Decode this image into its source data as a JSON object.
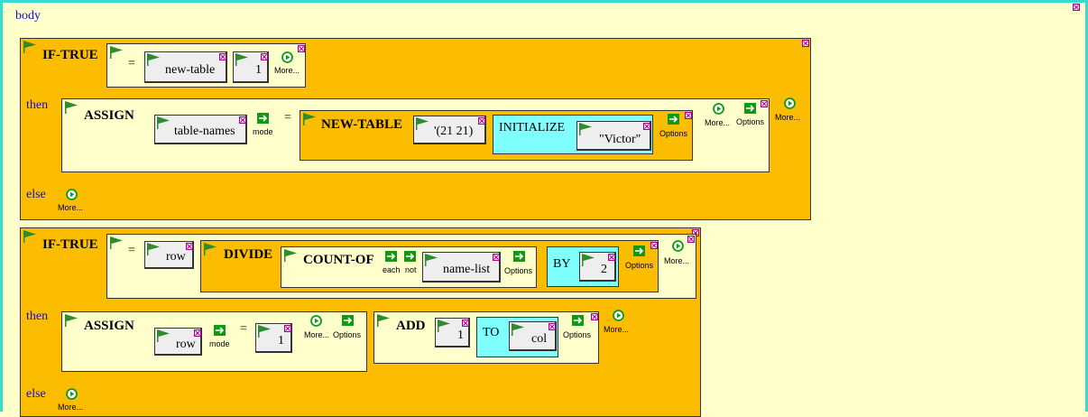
{
  "body_label": "body",
  "keywords": {
    "if_true": "IF-TRUE",
    "then": "then",
    "else": "else",
    "assign": "ASSIGN",
    "new_table": "NEW-TABLE",
    "initialize": "INITIALIZE",
    "divide": "DIVIDE",
    "count_of": "COUNT-OF",
    "by": "BY",
    "add": "ADD",
    "to": "TO",
    "equals": "="
  },
  "buttons": {
    "more": "More...",
    "options": "Options",
    "mode": "mode",
    "each": "each",
    "not": "not"
  },
  "block1": {
    "cond_left": "new-table",
    "cond_right": "1",
    "assign_target": "table-names",
    "dims": "'(21 21)",
    "init_value": "\"Victor\""
  },
  "block2": {
    "cond_left": "row",
    "count_list": "name-list",
    "divisor": "2",
    "assign_target": "row",
    "assign_value": "1",
    "add_value": "1",
    "add_target": "col"
  },
  "colors": {
    "frame_border": "#33ddcc",
    "background": "#ffffcc",
    "block_orange": "#fcbd00",
    "block_cyan": "#80ffff",
    "keyword_blue": "#1010cc",
    "flag_green": "#2e8b2e"
  }
}
